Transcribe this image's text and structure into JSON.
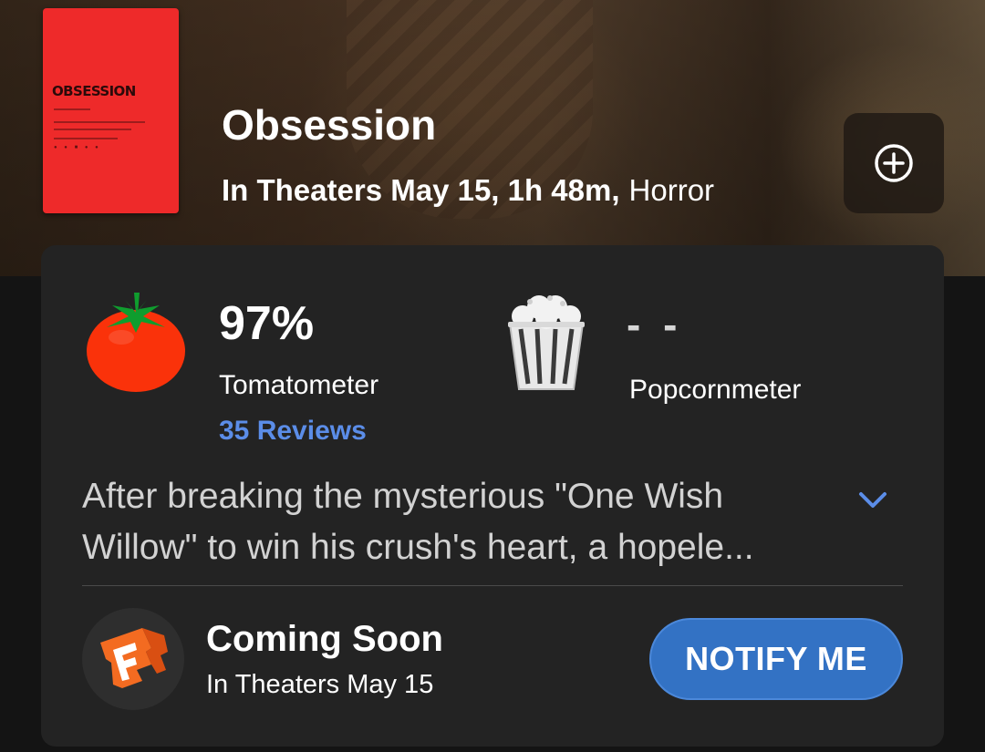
{
  "movie": {
    "title": "Obsession",
    "release": "In Theaters May 15, 1h 48m,",
    "genre": "Horror",
    "poster_title": "OBSESSION"
  },
  "header": {
    "add_icon": "plus-circle-icon"
  },
  "scores": {
    "tomatometer_value": "97%",
    "tomatometer_label": "Tomatometer",
    "reviews_link": "35 Reviews",
    "popcornmeter_value": "- -",
    "popcornmeter_label": "Popcornmeter"
  },
  "synopsis": {
    "line1": "After breaking the mysterious \"One Wish",
    "line2": "Willow\" to win his crush's heart, a hopele...",
    "expand_icon": "chevron-down-icon"
  },
  "showtimes": {
    "status": "Coming Soon",
    "date": "In Theaters May 15",
    "button_label": "NOTIFY ME",
    "provider_icon": "fandango-icon"
  },
  "colors": {
    "accent_blue": "#3372c4",
    "link_blue": "#5b8de8",
    "tomato_red": "#fa320a",
    "card_bg": "#232323"
  }
}
